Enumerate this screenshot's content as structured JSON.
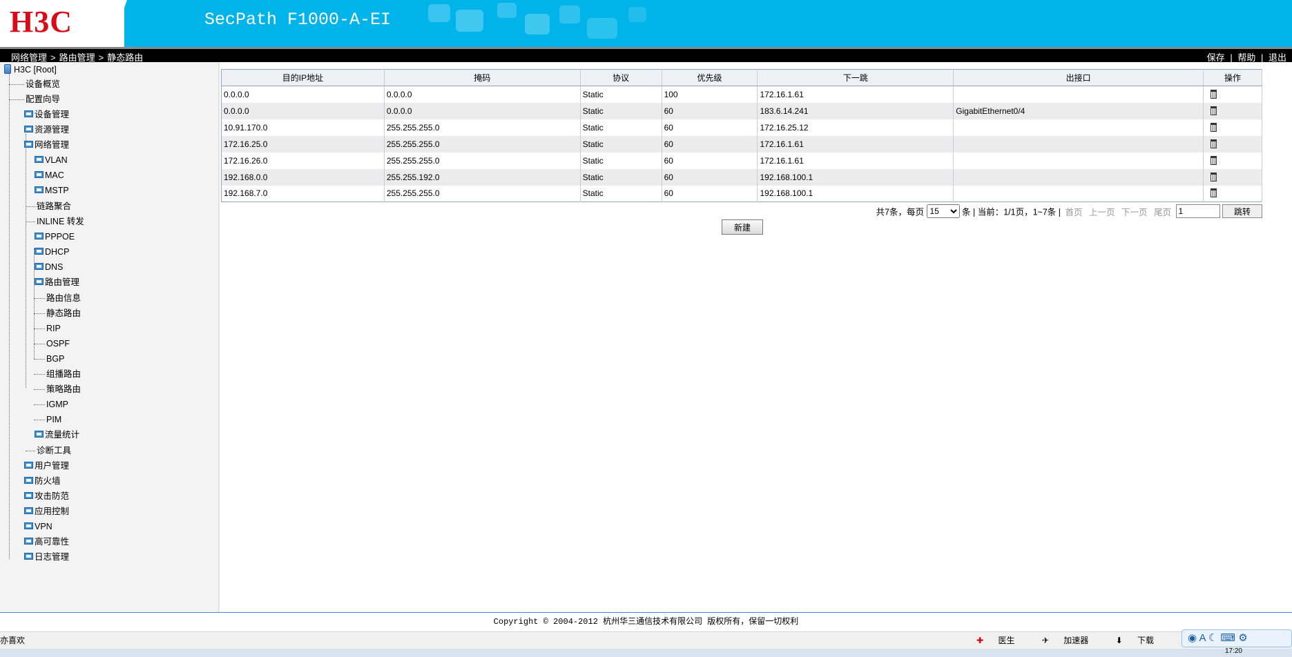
{
  "header": {
    "logo": "H3C",
    "product": "SecPath F1000-A-EI"
  },
  "breadcrumb": [
    "网络管理",
    "路由管理",
    "静态路由"
  ],
  "breadcrumb_sep": ">",
  "actions": {
    "save": "保存",
    "help": "帮助",
    "logout": "退出",
    "sep": "|"
  },
  "sidebar": {
    "root": "H3C [Root]",
    "items": [
      {
        "label": "设备概览"
      },
      {
        "label": "配置向导"
      },
      {
        "label": "设备管理"
      },
      {
        "label": "资源管理"
      },
      {
        "label": "网络管理"
      },
      {
        "label": "VLAN"
      },
      {
        "label": "MAC"
      },
      {
        "label": "MSTP"
      },
      {
        "label": "链路聚合"
      },
      {
        "label": "INLINE 转发"
      },
      {
        "label": "PPPOE"
      },
      {
        "label": "DHCP"
      },
      {
        "label": "DNS"
      },
      {
        "label": "路由管理"
      },
      {
        "label": "路由信息"
      },
      {
        "label": "静态路由"
      },
      {
        "label": "RIP"
      },
      {
        "label": "OSPF"
      },
      {
        "label": "BGP"
      },
      {
        "label": "组播路由"
      },
      {
        "label": "策略路由"
      },
      {
        "label": "IGMP"
      },
      {
        "label": "PIM"
      },
      {
        "label": "流量统计"
      },
      {
        "label": "诊断工具"
      },
      {
        "label": "用户管理"
      },
      {
        "label": "防火墙"
      },
      {
        "label": "攻击防范"
      },
      {
        "label": "应用控制"
      },
      {
        "label": "VPN"
      },
      {
        "label": "高可靠性"
      },
      {
        "label": "日志管理"
      }
    ]
  },
  "table": {
    "headers": [
      "目的IP地址",
      "掩码",
      "协议",
      "优先级",
      "下一跳",
      "出接口",
      "操作"
    ],
    "rows": [
      [
        "0.0.0.0",
        "0.0.0.0",
        "Static",
        "100",
        "172.16.1.61",
        ""
      ],
      [
        "0.0.0.0",
        "0.0.0.0",
        "Static",
        "60",
        "183.6.14.241",
        "GigabitEthernet0/4"
      ],
      [
        "10.91.170.0",
        "255.255.255.0",
        "Static",
        "60",
        "172.16.25.12",
        ""
      ],
      [
        "172.16.25.0",
        "255.255.255.0",
        "Static",
        "60",
        "172.16.1.61",
        ""
      ],
      [
        "172.16.26.0",
        "255.255.255.0",
        "Static",
        "60",
        "172.16.1.61",
        ""
      ],
      [
        "192.168.0.0",
        "255.255.192.0",
        "Static",
        "60",
        "192.168.100.1",
        ""
      ],
      [
        "192.168.7.0",
        "255.255.255.0",
        "Static",
        "60",
        "192.168.100.1",
        ""
      ]
    ]
  },
  "pager": {
    "total": "共7条，每页",
    "per_page": "15",
    "unit": "条",
    "current": "| 当前：1/1页，1~7条 |",
    "first": "首页",
    "prev": "上一页",
    "next": "下一页",
    "last": "尾页",
    "page_input": "1",
    "go": "跳转"
  },
  "new_button": "新建",
  "footer": "Copyright © 2004-2012 杭州华三通信技术有限公司 版权所有，保留一切权利",
  "statusbar": {
    "left": "亦喜欢",
    "doctor": "医生",
    "accelerator": "加速器",
    "download": "下载"
  },
  "ime": "A",
  "clock": "17:20"
}
